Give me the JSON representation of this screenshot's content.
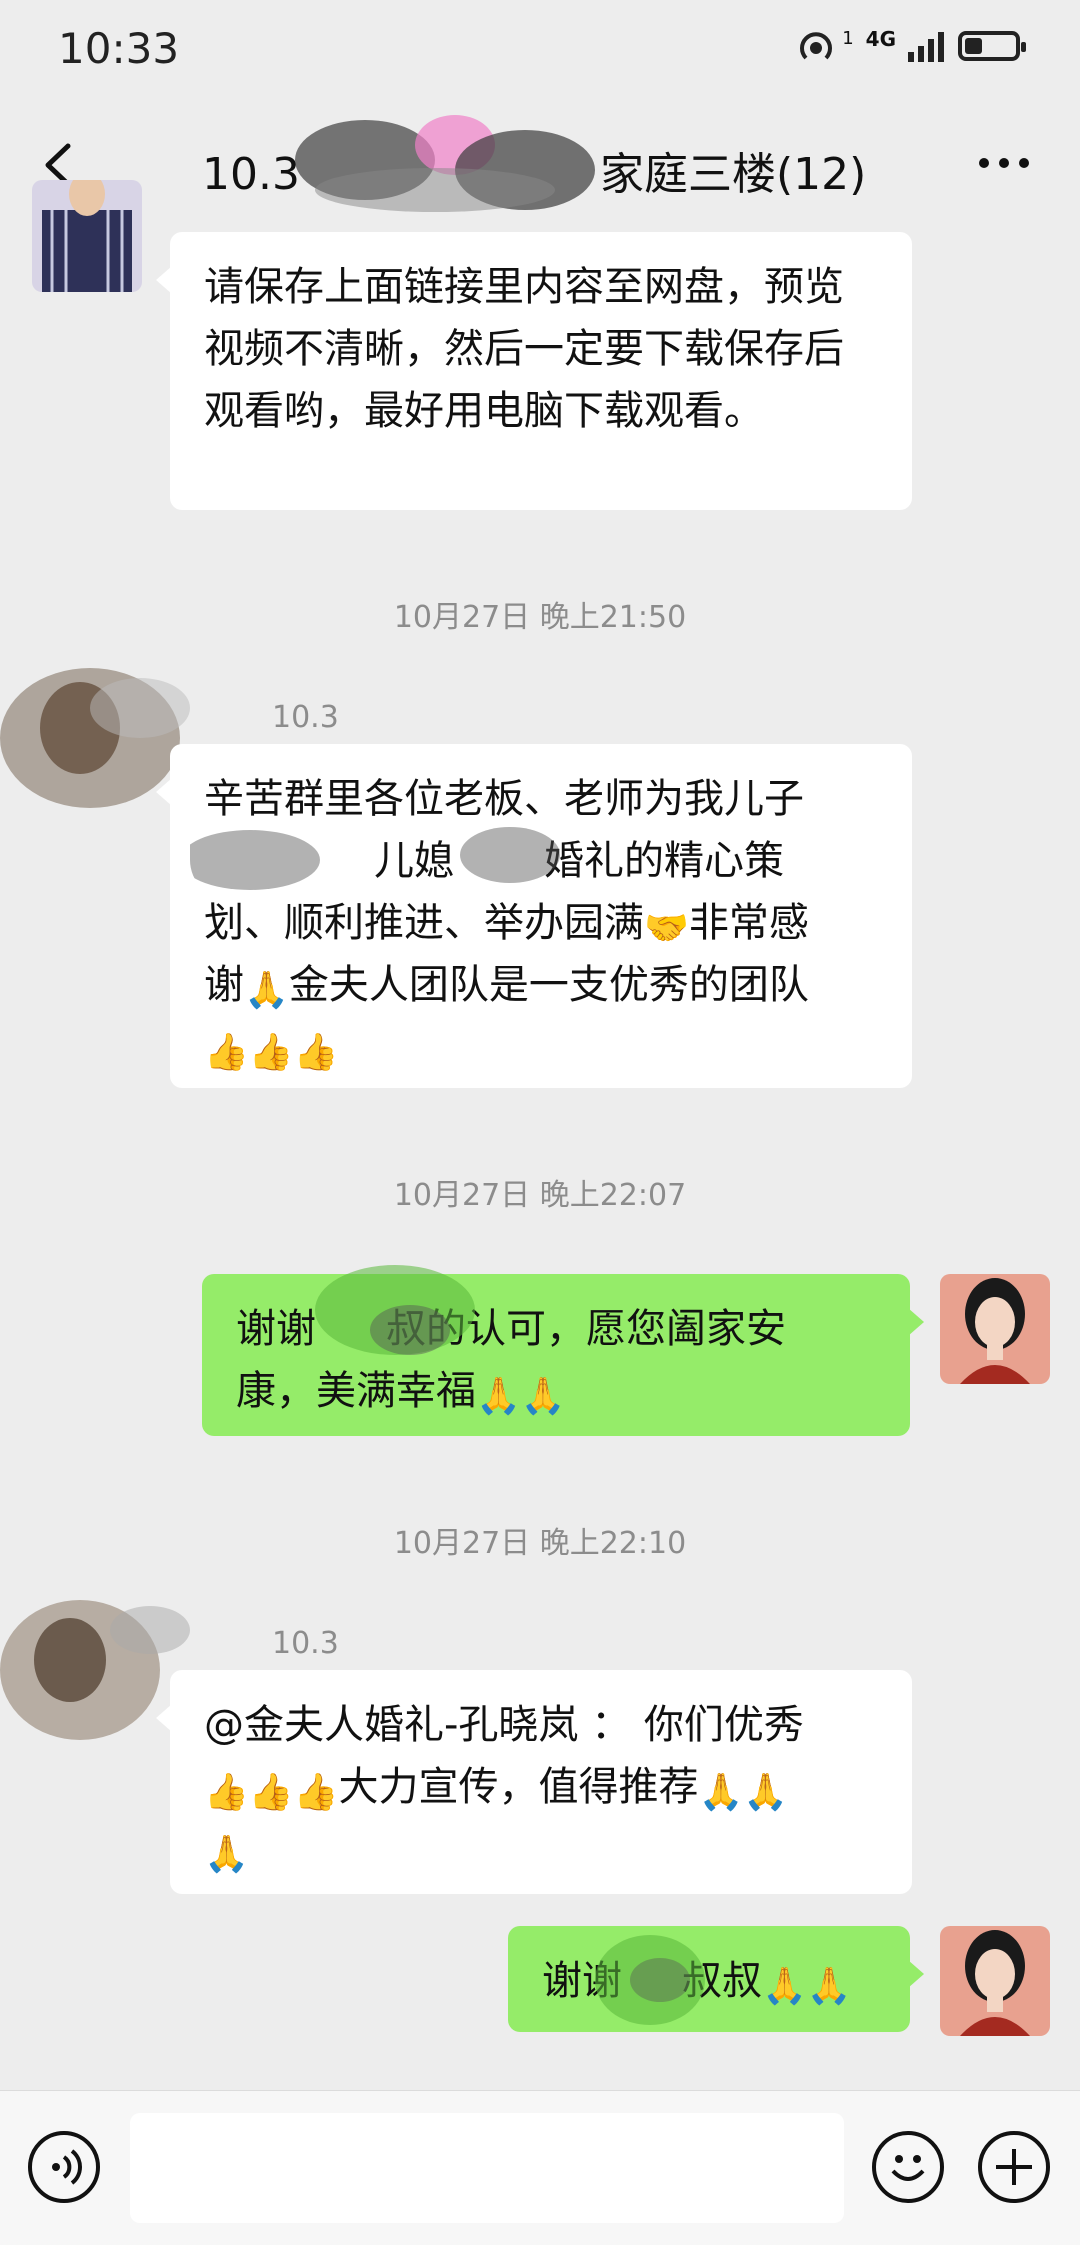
{
  "status_bar": {
    "time": "10:33",
    "network": "4G",
    "sim_index": "1",
    "battery_level": 0.35
  },
  "header": {
    "title": "10.3 ███ 家庭三楼(12)",
    "title_visible_start": "10.3",
    "title_visible_end": "家庭三楼(12)"
  },
  "messages": [
    {
      "sender": "other",
      "text": "请保存上面链接里内容至网盘，预览视频不清晰，然后一定要下载保存后观看哟，最好用电脑下载观看。"
    },
    {
      "timestamp": "10月27日 晚上21:50"
    },
    {
      "sender": "other",
      "name": "10.3",
      "line1": "辛苦群里各位老板、老师为我儿子",
      "line2": "儿媳",
      "line2b": "婚礼的精心策",
      "line3a": "划、顺利推进、举办园满",
      "line3b": "非常感",
      "line4a": "谢",
      "line4b": "金夫人团队是一支优秀的团队"
    },
    {
      "timestamp": "10月27日 晚上22:07"
    },
    {
      "sender": "self",
      "line1a": "谢谢",
      "line1b": "叔的认可，愿您阖家安",
      "line2": "康，美满幸福"
    },
    {
      "timestamp": "10月27日 晚上22:10"
    },
    {
      "sender": "other",
      "name": "10.3",
      "line1": "@金夫人婚礼-孔晓岚 ： 你们优秀",
      "line2": "大力宣传，值得推荐"
    },
    {
      "sender": "self",
      "line1a": "谢谢",
      "line1b": "叔叔"
    }
  ],
  "icons": {
    "back": "chevron-left-icon",
    "more": "more-dots-icon",
    "voice": "voice-icon",
    "emoji": "smiley-icon",
    "plus": "plus-icon",
    "thumbs": "👍",
    "pray": "🙏",
    "handshake": "🤝"
  },
  "colors": {
    "bubble_self": "#95ec69",
    "bubble_other": "#ffffff",
    "background": "#ededed"
  }
}
